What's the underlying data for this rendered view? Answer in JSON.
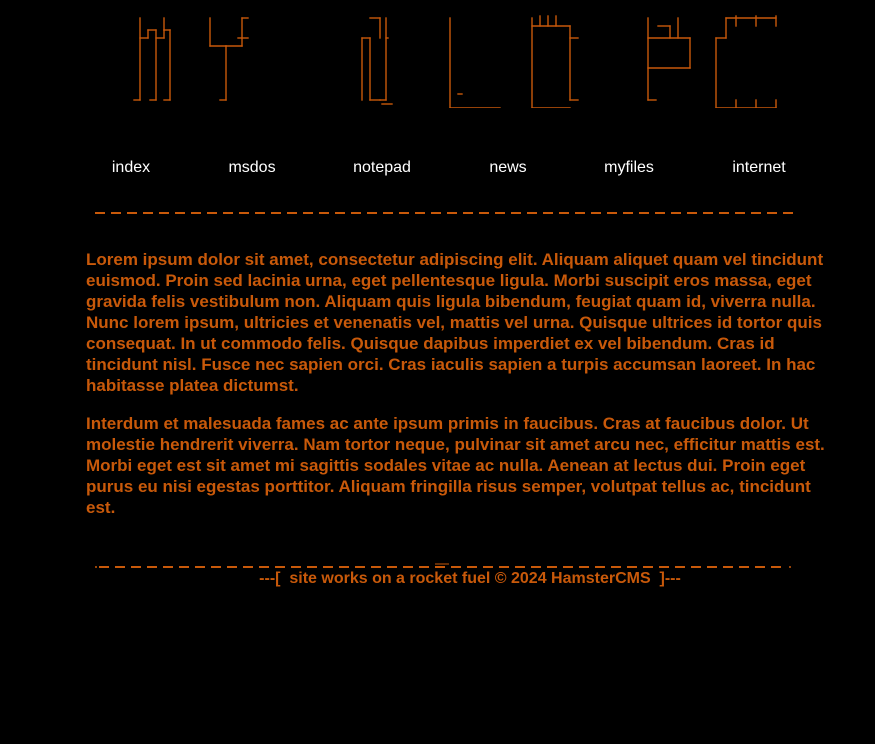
{
  "site": {
    "logo_text": "MY OLD PC"
  },
  "nav": {
    "items": [
      {
        "label": "index"
      },
      {
        "label": "msdos"
      },
      {
        "label": "notepad"
      },
      {
        "label": "news"
      },
      {
        "label": "myfiles"
      },
      {
        "label": "internet"
      }
    ]
  },
  "main": {
    "paragraphs": [
      "Lorem ipsum dolor sit amet, consectetur adipiscing elit. Aliquam aliquet quam vel tincidunt euismod. Proin sed lacinia urna, eget pellentesque ligula. Morbi suscipit eros massa, eget gravida felis vestibulum non. Aliquam quis ligula bibendum, feugiat quam id, viverra nulla. Nunc lorem ipsum, ultricies et venenatis vel, mattis vel urna. Quisque ultrices id tortor quis consequat. In ut commodo felis. Quisque dapibus imperdiet ex vel bibendum. Cras id tincidunt nisl. Fusce nec sapien orci. Cras iaculis sapien a turpis accumsan laoreet. In hac habitasse platea dictumst.",
      "Interdum et malesuada fames ac ante ipsum primis in faucibus. Cras at faucibus dolor. Ut molestie hendrerit viverra. Nam tortor neque, pulvinar sit amet arcu nec, efficitur mattis est. Morbi eget est sit amet mi sagittis sodales vitae ac nulla. Aenean at lectus dui. Proin eget purus eu nisi egestas porttitor. Aliquam fringilla risus semper, volutpat tellus ac, tincidunt est."
    ]
  },
  "footer": {
    "text": "---[  site works on a rocket fuel © 2024 HamsterCMS  ]---"
  },
  "colors": {
    "background": "#000000",
    "accent": "#c8590a",
    "nav_text": "#ffffff"
  }
}
